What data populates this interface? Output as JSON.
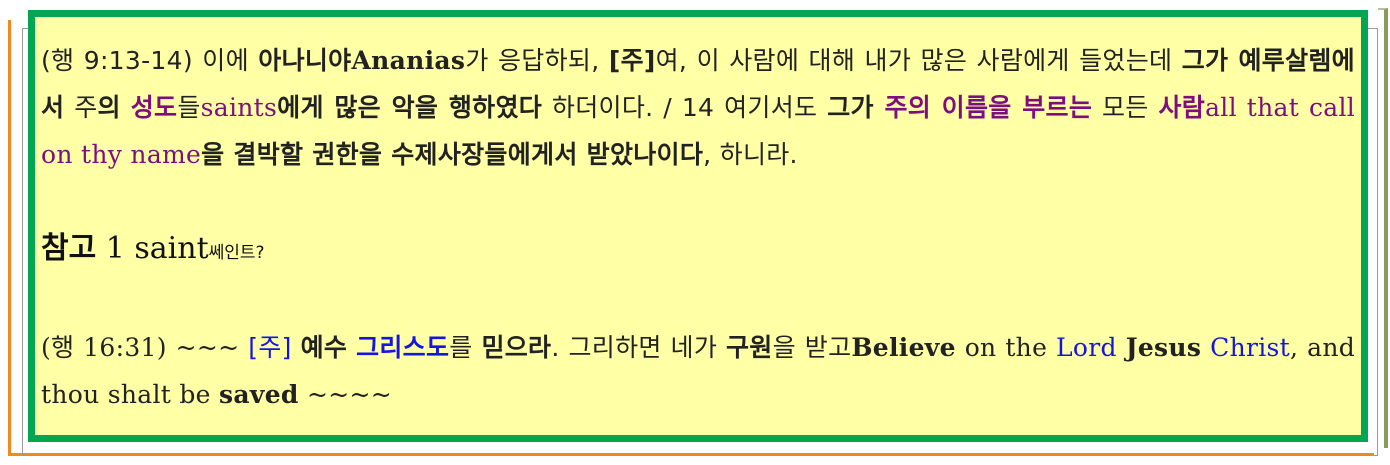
{
  "p1": {
    "ref": "(행 9:13-14) ",
    "t1": "이에 ",
    "t2": "아나니야",
    "t3": "Ananias",
    "t4": "가 응답하되, ",
    "t5": "[주]",
    "t6": "여, 이 사람에 대해 내가 많은 사람에게 들었는데 ",
    "t7": "그가 예루살렘에서",
    "t8": " 주",
    "t9": "의",
    "t10": " ",
    "t11": "성도",
    "t12": "들",
    "t13": "saints",
    "t14": "에게 많은 악을 행하였다",
    "t15": " 하더이다. / 14 여기서도 ",
    "t16": "그가 ",
    "t17": "주의 이름을 부르는",
    "t18": " 모든 ",
    "t19": "사람",
    "t20": "all that call on thy name",
    "t21": "을 결박할 권한을 수제사장들에게서 받았나이다",
    "t22": ", 하니라."
  },
  "note": {
    "label": "참고",
    "num": " 1 ",
    "word": "saint",
    "small": "쎄인트?"
  },
  "p2": {
    "ref": "(행 16:31) ~~~ ",
    "t1": "[주]",
    "t2": " ",
    "t3": "예수",
    "t4": " ",
    "t5": "그리스도",
    "t6": "를 ",
    "t7": "믿으라",
    "t8": ". 그리하면 네가 ",
    "t9": "구원",
    "t10": "을 받고",
    "t11": "Believe",
    "t12": " on the ",
    "t13": "Lord",
    "t14": " ",
    "t15": "Jesus",
    "t16": " ",
    "t17": "Christ",
    "t18": ", and thou shalt be ",
    "t19": "saved",
    "t20": " ~~~~"
  }
}
